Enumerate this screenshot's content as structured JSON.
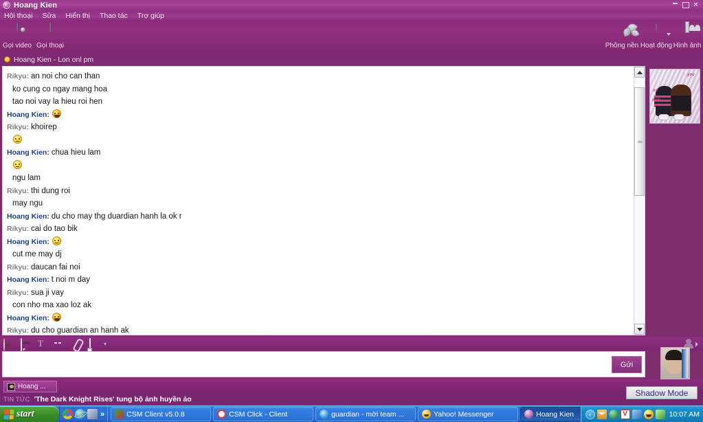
{
  "window": {
    "title": "Hoang Kien",
    "title_icon": "messenger-icon",
    "buttons": {
      "minimize": "minimize-icon",
      "maximize": "maximize-icon",
      "close": "✕"
    }
  },
  "menubar": {
    "items": [
      {
        "label": "Hội thoại"
      },
      {
        "label": "Sửa"
      },
      {
        "label": "Hiển thị"
      },
      {
        "label": "Thao tác"
      },
      {
        "label": "Trợ giúp"
      }
    ]
  },
  "toolbar": {
    "left_tools": [
      {
        "label": "Gọi video",
        "icon": "webcam-icon"
      },
      {
        "label": "Gọi thoại",
        "icon": "microphone-icon"
      }
    ],
    "right_tools": [
      {
        "label": "Phông nền",
        "icon": "leaf-icon",
        "has_dropdown": true
      },
      {
        "label": "Hoạt động",
        "icon": "chess-knight-icon",
        "has_dropdown": true
      },
      {
        "label": "Hình ảnh",
        "icon": "photo-icon",
        "has_dropdown": false
      }
    ]
  },
  "status": {
    "presence": "away",
    "presence_color": "#f2b81e",
    "name": "Hoang Kien",
    "separator": "-",
    "message": "Lon onl pm",
    "full_text": "Hoang Kien  -  Lon onl pm"
  },
  "chat": {
    "participants": {
      "other": "Rikyu",
      "self": "Hoang Kien"
    },
    "messages": [
      {
        "sender": "Rikyu",
        "side": "a",
        "text": "an noi cho can than",
        "emoji": null,
        "continuation": false
      },
      {
        "sender": null,
        "side": "a",
        "text": "ko cung co ngay mang hoa",
        "emoji": null,
        "continuation": true
      },
      {
        "sender": null,
        "side": "a",
        "text": "tao noi vay la hieu roi hen",
        "emoji": null,
        "continuation": true
      },
      {
        "sender": "Hoang Kien",
        "side": "b",
        "text": "",
        "emoji": "laugh",
        "continuation": false
      },
      {
        "sender": "Rikyu",
        "side": "a",
        "text": "khoirep",
        "emoji": null,
        "continuation": false
      },
      {
        "sender": null,
        "side": "a",
        "text": "",
        "emoji": "smile",
        "continuation": true
      },
      {
        "sender": "Hoang Kien",
        "side": "b",
        "text": "chua hieu lam",
        "emoji": null,
        "continuation": false
      },
      {
        "sender": null,
        "side": "b",
        "text": "",
        "emoji": "smile",
        "continuation": true
      },
      {
        "sender": null,
        "side": "b",
        "text": "ngu lam",
        "emoji": null,
        "continuation": true
      },
      {
        "sender": "Rikyu",
        "side": "a",
        "text": "thi dung roi",
        "emoji": null,
        "continuation": false
      },
      {
        "sender": null,
        "side": "a",
        "text": "may ngu",
        "emoji": null,
        "continuation": true
      },
      {
        "sender": "Hoang Kien",
        "side": "b",
        "text": "du cho may thg duardian hanh la ok r",
        "emoji": null,
        "continuation": false
      },
      {
        "sender": "Rikyu",
        "side": "a",
        "text": "cai do tao bik",
        "emoji": null,
        "continuation": false
      },
      {
        "sender": "Hoang Kien",
        "side": "b",
        "text": "",
        "emoji": "smile",
        "continuation": false
      },
      {
        "sender": null,
        "side": "b",
        "text": "cut me may dj",
        "emoji": null,
        "continuation": true
      },
      {
        "sender": "Rikyu",
        "side": "a",
        "text": "daucan fai noi",
        "emoji": null,
        "continuation": false
      },
      {
        "sender": "Hoang Kien",
        "side": "b",
        "text": "t noi m day",
        "emoji": null,
        "continuation": false
      },
      {
        "sender": "Rikyu",
        "side": "a",
        "text": "sua ji vay",
        "emoji": null,
        "continuation": false
      },
      {
        "sender": null,
        "side": "a",
        "text": "con nho ma xao loz ak",
        "emoji": null,
        "continuation": true
      },
      {
        "sender": "Hoang Kien",
        "side": "b",
        "text": "",
        "emoji": "laugh",
        "continuation": false
      },
      {
        "sender": "Rikyu",
        "side": "a",
        "text": "du cho guardian an hanh ak",
        "emoji": null,
        "continuation": false
      }
    ],
    "scrollbar": {
      "up_arrow": "scroll-up-icon",
      "down_arrow": "scroll-down-icon"
    }
  },
  "display_picture": {
    "alt": "chibi couple avatar",
    "overlay_words": [
      "love",
      "you",
      "so"
    ]
  },
  "input_toolbar": {
    "tools": [
      {
        "name": "emoticon-icon",
        "label": "Emoticons"
      },
      {
        "name": "ping-bubble-icon",
        "label": "IMVironment bubble"
      },
      {
        "name": "text-format-icon",
        "label": "T"
      },
      {
        "name": "buzz-icon",
        "label": "Buzz"
      },
      {
        "name": "attach-file-icon",
        "label": "Attach"
      },
      {
        "name": "send-image-icon",
        "label": "Send image"
      }
    ],
    "contact_icon": "contact-icon"
  },
  "compose": {
    "value": "",
    "placeholder": "",
    "send_label": "Gửi"
  },
  "webcam": {
    "alt": "webcam preview"
  },
  "conversation_tab": {
    "label": "Hoang ...",
    "icon": "contact-avatar-icon"
  },
  "ticker": {
    "tag": "TIN TỨC",
    "headline": "'The Dark Knight Rises' tung bộ ảnh huyền ảo"
  },
  "shadow_mode": {
    "label": "Shadow Mode"
  },
  "taskbar": {
    "start_label": "start",
    "quick_launch": [
      {
        "name": "chrome-icon"
      },
      {
        "name": "internet-explorer-icon"
      },
      {
        "name": "show-desktop-icon"
      },
      {
        "name": "more-chevron-icon",
        "label": "»"
      }
    ],
    "tasks": [
      {
        "label": "CSM Client v5.0.8",
        "icon": "csm-client-icon",
        "active": false
      },
      {
        "label": "CSM Click - Client",
        "icon": "csm-click-icon",
        "active": false
      },
      {
        "label": "guardian - mời team ...",
        "icon": "firefox-icon",
        "active": false
      },
      {
        "label": "Yahoo! Messenger",
        "icon": "yahoo-icon",
        "active": false
      },
      {
        "label": "Hoang Kien",
        "icon": "messenger-icon",
        "active": true
      }
    ],
    "tray": {
      "chevron": "‹",
      "icons": [
        {
          "name": "mail-icon"
        },
        {
          "name": "globe-icon"
        },
        {
          "name": "vbox-icon",
          "label": "V"
        },
        {
          "name": "messenger-tray-icon"
        },
        {
          "name": "yahoo-tray-icon"
        },
        {
          "name": "network-icon"
        }
      ],
      "clock": "10:07 AM"
    }
  },
  "colors": {
    "window_chrome": "#8a2b7b",
    "title_bar": "#a9429a",
    "chat_bg": "#ffffff",
    "nick_self": "#1b3f8f",
    "nick_other": "#7c7c82",
    "taskbar_blue": "#2a6fd0",
    "start_green": "#3f8f2b"
  }
}
